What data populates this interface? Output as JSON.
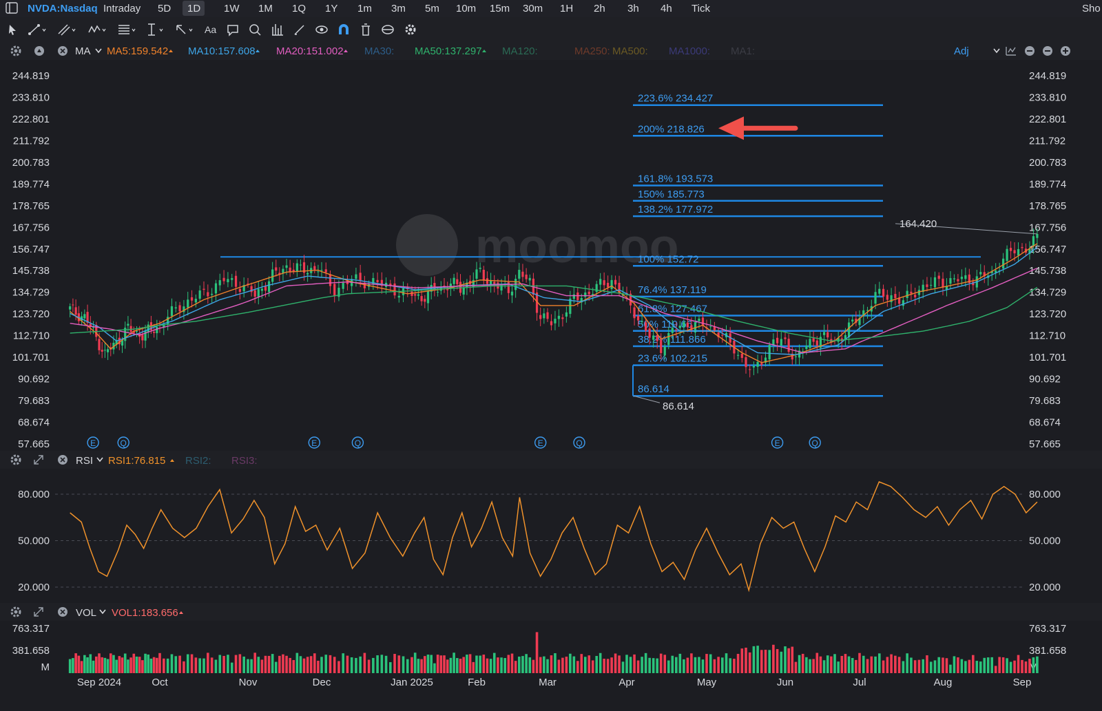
{
  "header": {
    "symbol": "NVDA:Nasdaq",
    "periods": [
      "Intraday",
      "5D",
      "1D",
      "1W",
      "1M",
      "1Q",
      "1Y",
      "1m",
      "3m",
      "5m",
      "10m",
      "15m",
      "30m",
      "1H",
      "2h",
      "3h",
      "4h",
      "Tick"
    ],
    "active_period": "1D",
    "right_text": "Sho"
  },
  "toolbar": {
    "icons": [
      "cursor-icon",
      "line-tool-icon",
      "channel-tool-icon",
      "wave-tool-icon",
      "fib-tool-icon",
      "vertical-line-icon",
      "arrow-tool-icon",
      "text-tool-icon",
      "comment-icon",
      "zoom-icon",
      "pattern-icon",
      "brush-icon",
      "eye-icon",
      "magnet-icon",
      "trash-icon",
      "sync-icon",
      "gear-icon"
    ],
    "text_icon_label": "Aa"
  },
  "ma_bar": {
    "indicator": "MA",
    "items": [
      {
        "label": "MA5:159.542",
        "color": "#f0822b",
        "active": true
      },
      {
        "label": "MA10:157.608",
        "color": "#3ea6e8",
        "active": true
      },
      {
        "label": "MA20:151.002",
        "color": "#e25ec0",
        "active": true
      },
      {
        "label": "MA30:",
        "color": "#2d5d88",
        "active": false
      },
      {
        "label": "MA50:137.297",
        "color": "#2fb26c",
        "active": true
      },
      {
        "label": "MA120:",
        "color": "#2b6b55",
        "active": false
      },
      {
        "label": "MA250:",
        "color": "#6e3a2a",
        "active": false
      },
      {
        "label": "MA500:",
        "color": "#6b5a24",
        "active": false
      },
      {
        "label": "MA1000:",
        "color": "#3b3a78",
        "active": false
      },
      {
        "label": "MA1:",
        "color": "#3b3c44",
        "active": false
      }
    ],
    "adj_label": "Adj"
  },
  "rsi_bar": {
    "indicator": "RSI",
    "items": [
      {
        "label": "RSI1:76.815",
        "color": "#f0922b",
        "active": true
      },
      {
        "label": "RSI2:",
        "color": "#2d5d70",
        "active": false
      },
      {
        "label": "RSI3:",
        "color": "#6a3a66",
        "active": false
      }
    ]
  },
  "vol_bar": {
    "indicator": "VOL",
    "items": [
      {
        "label": "VOL1:183.656",
        "color": "#ff6b6b",
        "active": true
      }
    ]
  },
  "colors": {
    "up": "#2bc37c",
    "down": "#ef3b52",
    "fib_line": "#1e88e5",
    "fib_text": "#3d9df2",
    "rsi": "#f0922b",
    "arrow": "#f0504a"
  },
  "watermark": "moomoo",
  "chart_data": {
    "type": "candlestick",
    "price_axis_labels": [
      "244.819",
      "233.810",
      "222.801",
      "211.792",
      "200.783",
      "189.774",
      "178.765",
      "167.756",
      "156.747",
      "145.738",
      "134.729",
      "123.720",
      "112.710",
      "101.701",
      "90.692",
      "79.683",
      "68.674",
      "57.665"
    ],
    "y_range": [
      57.665,
      244.819
    ],
    "month_labels": [
      "Sep 2024",
      "Oct",
      "Nov",
      "Dec",
      "Jan 2025",
      "Feb",
      "Mar",
      "Apr",
      "May",
      "Jun",
      "Jul",
      "Aug",
      "Sep"
    ],
    "last_price_label": "164.420",
    "last_price": 164.42,
    "low_label": "86.614",
    "low_price": 86.614,
    "fibonacci": [
      {
        "label": "223.6% 234.427",
        "price": 234.427
      },
      {
        "label": "200% 218.826",
        "price": 218.826
      },
      {
        "label": "161.8% 193.573",
        "price": 193.573
      },
      {
        "label": "150% 185.773",
        "price": 185.773
      },
      {
        "label": "138.2% 177.972",
        "price": 177.972
      },
      {
        "label": "100% 152.72",
        "price": 152.72
      },
      {
        "label": "76.4% 137.119",
        "price": 137.119
      },
      {
        "label": "61.8% 127.467",
        "price": 127.467
      },
      {
        "label": "50% 119.667",
        "price": 119.667
      },
      {
        "label": "38.2% 111.866",
        "price": 111.866
      },
      {
        "label": "23.6% 102.215",
        "price": 102.215
      },
      {
        "label": "86.614",
        "price": 86.614
      }
    ],
    "horizontal_line": {
      "price": 152.72
    },
    "arrow_annotation": {
      "points_to": "200% 218.826"
    },
    "event_markers": [
      {
        "label": "E",
        "month_pos": 0.4
      },
      {
        "label": "Q",
        "month_pos": 0.9
      },
      {
        "label": "E",
        "month_pos": 3.4
      },
      {
        "label": "Q",
        "month_pos": 3.9
      },
      {
        "label": "E",
        "month_pos": 6.4
      },
      {
        "label": "Q",
        "month_pos": 6.9
      },
      {
        "label": "E",
        "month_pos": 9.4
      },
      {
        "label": "Q",
        "month_pos": 9.9
      }
    ],
    "close_waypoints": [
      [
        0,
        126
      ],
      [
        5,
        122
      ],
      [
        9,
        112
      ],
      [
        12,
        103
      ],
      [
        15,
        108
      ],
      [
        20,
        116
      ],
      [
        25,
        113
      ],
      [
        31,
        118
      ],
      [
        36,
        128
      ],
      [
        42,
        134
      ],
      [
        47,
        141
      ],
      [
        52,
        138
      ],
      [
        55,
        133
      ],
      [
        60,
        143
      ],
      [
        64,
        148
      ],
      [
        68,
        146
      ],
      [
        73,
        147
      ],
      [
        77,
        136
      ],
      [
        81,
        141
      ],
      [
        86,
        140
      ],
      [
        90,
        137
      ],
      [
        94,
        134
      ],
      [
        98,
        132
      ],
      [
        102,
        136
      ],
      [
        107,
        139
      ],
      [
        110,
        137
      ],
      [
        113,
        140
      ],
      [
        116,
        145
      ],
      [
        120,
        138
      ],
      [
        124,
        136
      ],
      [
        127,
        144
      ],
      [
        130,
        140
      ],
      [
        133,
        122
      ],
      [
        136,
        119
      ],
      [
        139,
        124
      ],
      [
        142,
        131
      ],
      [
        147,
        136
      ],
      [
        152,
        141
      ],
      [
        155,
        133
      ],
      [
        158,
        125
      ],
      [
        162,
        112
      ],
      [
        165,
        107
      ],
      [
        168,
        115
      ],
      [
        172,
        119
      ],
      [
        176,
        118
      ],
      [
        180,
        115
      ],
      [
        183,
        108
      ],
      [
        186,
        101
      ],
      [
        189,
        94
      ],
      [
        191,
        100
      ],
      [
        194,
        111
      ],
      [
        197,
        108
      ],
      [
        200,
        102
      ],
      [
        203,
        107
      ],
      [
        207,
        113
      ],
      [
        211,
        109
      ],
      [
        214,
        115
      ],
      [
        218,
        122
      ],
      [
        222,
        133
      ],
      [
        226,
        133
      ],
      [
        229,
        130
      ],
      [
        233,
        137
      ],
      [
        238,
        140
      ],
      [
        243,
        141
      ],
      [
        248,
        142
      ],
      [
        252,
        144
      ],
      [
        255,
        152
      ],
      [
        258,
        156
      ],
      [
        262,
        158
      ],
      [
        264,
        162
      ]
    ],
    "moving_averages": [
      {
        "name": "MA5",
        "color": "#f0822b",
        "waypoints": [
          [
            0,
            125
          ],
          [
            9,
            114
          ],
          [
            14,
            106
          ],
          [
            22,
            115
          ],
          [
            31,
            119
          ],
          [
            42,
            131
          ],
          [
            52,
            138
          ],
          [
            64,
            145
          ],
          [
            73,
            146
          ],
          [
            81,
            140
          ],
          [
            94,
            134
          ],
          [
            107,
            137
          ],
          [
            116,
            141
          ],
          [
            127,
            140
          ],
          [
            133,
            128
          ],
          [
            142,
            128
          ],
          [
            152,
            138
          ],
          [
            158,
            129
          ],
          [
            165,
            111
          ],
          [
            176,
            118
          ],
          [
            186,
            104
          ],
          [
            191,
            99
          ],
          [
            200,
            103
          ],
          [
            211,
            110
          ],
          [
            222,
            128
          ],
          [
            233,
            135
          ],
          [
            248,
            141
          ],
          [
            258,
            152
          ],
          [
            264,
            159.5
          ]
        ]
      },
      {
        "name": "MA10",
        "color": "#3ea6e8",
        "waypoints": [
          [
            0,
            124
          ],
          [
            10,
            117
          ],
          [
            16,
            110
          ],
          [
            24,
            114
          ],
          [
            34,
            120
          ],
          [
            46,
            131
          ],
          [
            58,
            138
          ],
          [
            70,
            143
          ],
          [
            82,
            141
          ],
          [
            96,
            136
          ],
          [
            110,
            138
          ],
          [
            124,
            139
          ],
          [
            134,
            132
          ],
          [
            144,
            130
          ],
          [
            154,
            136
          ],
          [
            162,
            128
          ],
          [
            170,
            115
          ],
          [
            180,
            115
          ],
          [
            190,
            104
          ],
          [
            200,
            103
          ],
          [
            212,
            108
          ],
          [
            224,
            125
          ],
          [
            236,
            134
          ],
          [
            248,
            140
          ],
          [
            258,
            149
          ],
          [
            264,
            157.6
          ]
        ]
      },
      {
        "name": "MA20",
        "color": "#e25ec0",
        "waypoints": [
          [
            0,
            119
          ],
          [
            14,
            116
          ],
          [
            24,
            113
          ],
          [
            36,
            119
          ],
          [
            50,
            128
          ],
          [
            64,
            138
          ],
          [
            80,
            140
          ],
          [
            96,
            137
          ],
          [
            112,
            138
          ],
          [
            128,
            139
          ],
          [
            140,
            133
          ],
          [
            154,
            133
          ],
          [
            166,
            124
          ],
          [
            178,
            118
          ],
          [
            190,
            110
          ],
          [
            202,
            104
          ],
          [
            214,
            106
          ],
          [
            226,
            116
          ],
          [
            240,
            128
          ],
          [
            252,
            137
          ],
          [
            264,
            147
          ]
        ]
      },
      {
        "name": "MA50",
        "color": "#2fb26c",
        "waypoints": [
          [
            0,
            114
          ],
          [
            22,
            116
          ],
          [
            40,
            120
          ],
          [
            60,
            127
          ],
          [
            80,
            134
          ],
          [
            100,
            136
          ],
          [
            120,
            138
          ],
          [
            140,
            138
          ],
          [
            155,
            134
          ],
          [
            170,
            128
          ],
          [
            185,
            120
          ],
          [
            198,
            114
          ],
          [
            210,
            110
          ],
          [
            222,
            112
          ],
          [
            234,
            115
          ],
          [
            246,
            120
          ],
          [
            256,
            127
          ],
          [
            264,
            137.3
          ]
        ]
      }
    ],
    "rsi": {
      "axis_labels": [
        "80.000",
        "50.000",
        "20.000"
      ],
      "levels": [
        80,
        50,
        20
      ],
      "waypoints": [
        [
          0,
          68
        ],
        [
          4,
          62
        ],
        [
          7,
          45
        ],
        [
          10,
          30
        ],
        [
          13,
          27
        ],
        [
          17,
          44
        ],
        [
          20,
          60
        ],
        [
          23,
          54
        ],
        [
          26,
          45
        ],
        [
          29,
          58
        ],
        [
          32,
          70
        ],
        [
          35,
          58
        ],
        [
          38,
          52
        ],
        [
          41,
          58
        ],
        [
          44,
          72
        ],
        [
          47,
          83
        ],
        [
          50,
          55
        ],
        [
          53,
          64
        ],
        [
          56,
          76
        ],
        [
          59,
          65
        ],
        [
          62,
          35
        ],
        [
          65,
          48
        ],
        [
          68,
          72
        ],
        [
          71,
          56
        ],
        [
          74,
          60
        ],
        [
          77,
          44
        ],
        [
          80,
          58
        ],
        [
          83,
          32
        ],
        [
          86,
          42
        ],
        [
          89,
          68
        ],
        [
          92,
          52
        ],
        [
          95,
          40
        ],
        [
          98,
          55
        ],
        [
          101,
          65
        ],
        [
          104,
          38
        ],
        [
          107,
          28
        ],
        [
          110,
          52
        ],
        [
          113,
          68
        ],
        [
          116,
          46
        ],
        [
          119,
          58
        ],
        [
          122,
          75
        ],
        [
          125,
          52
        ],
        [
          128,
          40
        ],
        [
          130,
          78
        ],
        [
          133,
          42
        ],
        [
          136,
          27
        ],
        [
          139,
          38
        ],
        [
          142,
          55
        ],
        [
          145,
          65
        ],
        [
          148,
          45
        ],
        [
          151,
          28
        ],
        [
          154,
          35
        ],
        [
          157,
          60
        ],
        [
          160,
          55
        ],
        [
          163,
          72
        ],
        [
          166,
          48
        ],
        [
          169,
          30
        ],
        [
          172,
          36
        ],
        [
          175,
          25
        ],
        [
          178,
          44
        ],
        [
          181,
          58
        ],
        [
          184,
          42
        ],
        [
          187,
          28
        ],
        [
          190,
          35
        ],
        [
          192,
          18
        ],
        [
          195,
          48
        ],
        [
          198,
          65
        ],
        [
          201,
          58
        ],
        [
          204,
          62
        ],
        [
          207,
          45
        ],
        [
          210,
          30
        ],
        [
          213,
          46
        ],
        [
          216,
          66
        ],
        [
          219,
          62
        ],
        [
          222,
          75
        ],
        [
          225,
          70
        ],
        [
          228,
          88
        ],
        [
          231,
          85
        ],
        [
          234,
          78
        ],
        [
          237,
          70
        ],
        [
          240,
          65
        ],
        [
          243,
          72
        ],
        [
          246,
          60
        ],
        [
          249,
          70
        ],
        [
          252,
          76
        ],
        [
          255,
          64
        ],
        [
          258,
          80
        ],
        [
          261,
          85
        ],
        [
          264,
          80
        ],
        [
          267,
          68
        ],
        [
          270,
          75
        ]
      ]
    },
    "volume": {
      "axis_labels": [
        "763.317",
        "381.658",
        "M"
      ],
      "max": 763.317,
      "peak_index": 132,
      "peak_value": 700
    }
  }
}
